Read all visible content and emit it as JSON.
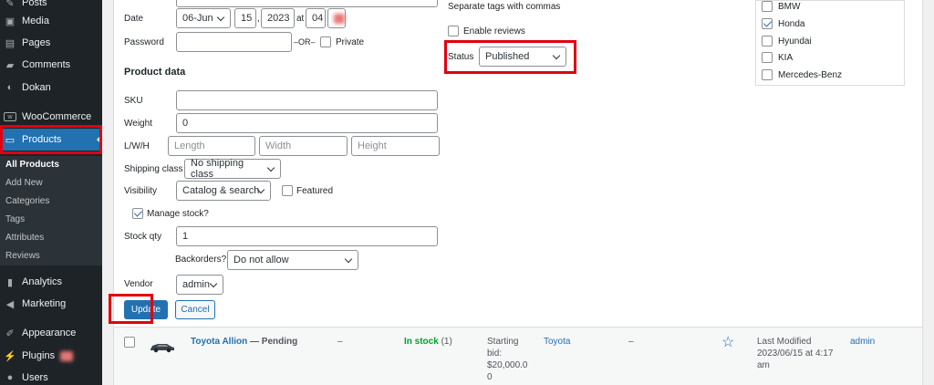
{
  "sidebar": {
    "items": [
      {
        "label": "Posts",
        "icon": "pin-icon"
      },
      {
        "label": "Media",
        "icon": "media-icon"
      },
      {
        "label": "Pages",
        "icon": "pages-icon"
      },
      {
        "label": "Comments",
        "icon": "comments-icon"
      },
      {
        "label": "Dokan",
        "icon": "dokan-icon"
      },
      {
        "label": "WooCommerce",
        "icon": "woocommerce-icon"
      },
      {
        "label": "Products",
        "icon": "products-icon"
      },
      {
        "label": "Analytics",
        "icon": "analytics-icon"
      },
      {
        "label": "Marketing",
        "icon": "megaphone-icon"
      },
      {
        "label": "Appearance",
        "icon": "brush-icon"
      },
      {
        "label": "Plugins",
        "icon": "plugin-icon"
      },
      {
        "label": "Users",
        "icon": "user-icon"
      }
    ],
    "submenu": [
      "All Products",
      "Add New",
      "Categories",
      "Tags",
      "Attributes",
      "Reviews"
    ],
    "accent": "#2271b1"
  },
  "quickedit": {
    "date_label": "Date",
    "date_month": "06-Jun",
    "date_day": "15",
    "date_year": "2023",
    "at_label": "at",
    "date_hour": "04",
    "date_sep": ",",
    "password_label": "Password",
    "or_text": "–OR–",
    "private_label": "Private",
    "tags_hint": "Separate tags with commas",
    "enable_reviews_label": "Enable reviews",
    "status_label": "Status",
    "status_value": "Published",
    "product_data_title": "Product data",
    "sku_label": "SKU",
    "sku_value": "",
    "weight_label": "Weight",
    "weight_value": "0",
    "lwh_label": "L/W/H",
    "length_placeholder": "Length",
    "width_placeholder": "Width",
    "height_placeholder": "Height",
    "shipping_class_label": "Shipping class",
    "shipping_class_value": "No shipping class",
    "visibility_label": "Visibility",
    "visibility_value": "Catalog & search",
    "featured_label": "Featured",
    "manage_stock_label": "Manage stock?",
    "stock_qty_label": "Stock qty",
    "stock_qty_value": "1",
    "backorders_label": "Backorders?",
    "backorders_value": "Do not allow",
    "vendor_label": "Vendor",
    "vendor_value": "admin",
    "update_label": "Update",
    "cancel_label": "Cancel"
  },
  "brands": [
    {
      "label": "BMW",
      "checked": false
    },
    {
      "label": "Honda",
      "checked": true
    },
    {
      "label": "Hyundai",
      "checked": false
    },
    {
      "label": "KIA",
      "checked": false
    },
    {
      "label": "Mercedes-Benz",
      "checked": false
    }
  ],
  "product_row": {
    "name": "Toyota Allion",
    "state": "— Pending",
    "sku": "–",
    "stock_status": "In stock",
    "stock_count": "(1)",
    "price_line1": "Starting",
    "price_line2": "bid:",
    "price_line3": "$20,000.0",
    "price_line4": "0",
    "category": "Toyota",
    "tags": "–",
    "date_line1": "Last Modified",
    "date_line2": "2023/06/15 at 4:17",
    "date_line3": "am",
    "author": "admin"
  },
  "colors": {
    "highlight": "#e2000f",
    "link": "#2271b1",
    "instock": "#00a32a"
  }
}
